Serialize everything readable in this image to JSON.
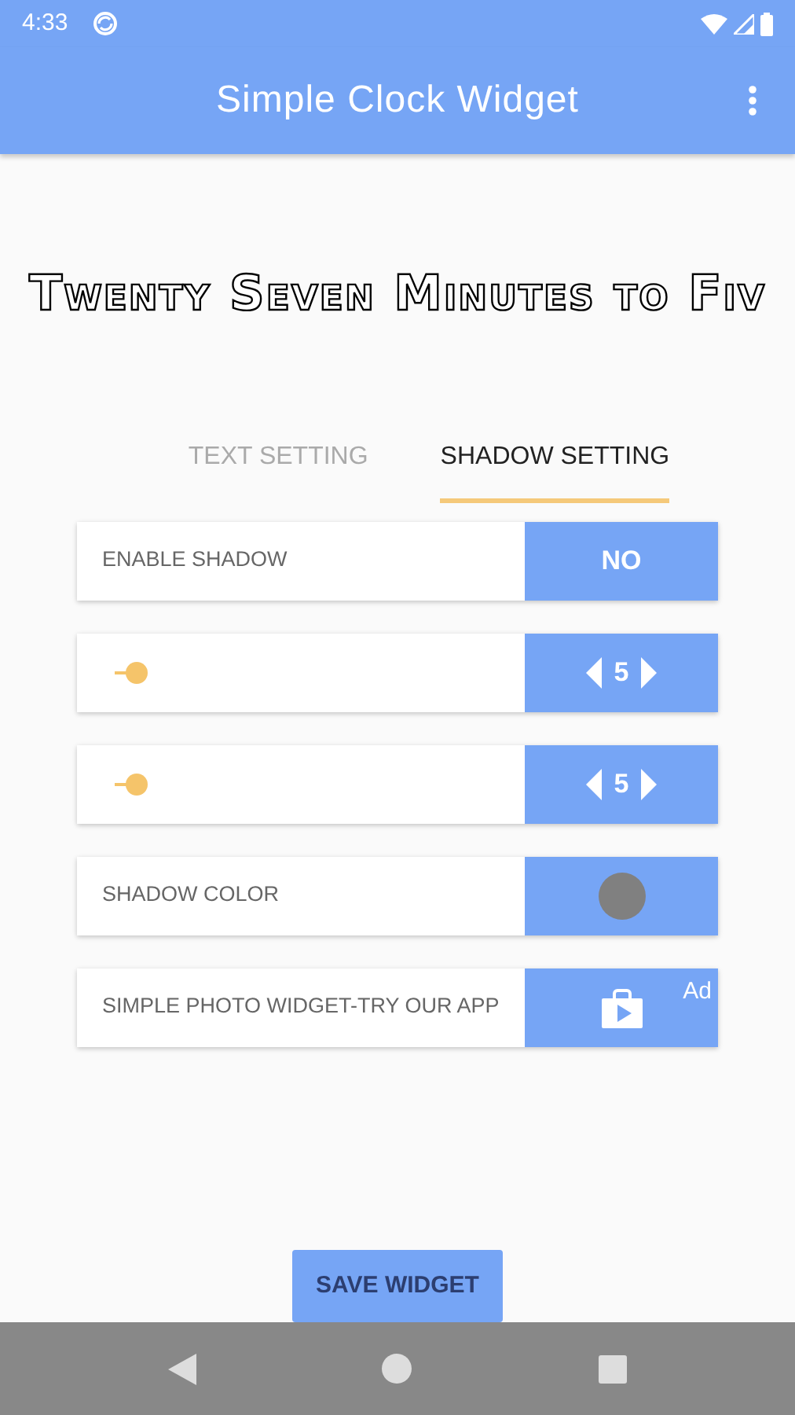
{
  "status_bar": {
    "time": "4:33"
  },
  "app_bar": {
    "title": "Simple Clock Widget"
  },
  "clock_text": "Twenty Seven Minutes to Fiv",
  "tabs": [
    {
      "label": "TEXT SETTING",
      "selected": false
    },
    {
      "label": "SHADOW SETTING",
      "selected": true
    }
  ],
  "rows": [
    {
      "kind": "toggle",
      "label": "ENABLE SHADOW",
      "value": "NO",
      "on": false
    },
    {
      "kind": "stepper",
      "level": 0.03,
      "value": "5"
    },
    {
      "kind": "stepper",
      "level": 0.03,
      "value": "5"
    },
    {
      "kind": "color",
      "label": "SHADOW COLOR",
      "color": "#808080"
    },
    {
      "kind": "ad",
      "label": "SIMPLE PHOTO WIDGET-TRY OUR APP",
      "badge": "Ad"
    }
  ],
  "save_button": "SAVE WIDGET"
}
